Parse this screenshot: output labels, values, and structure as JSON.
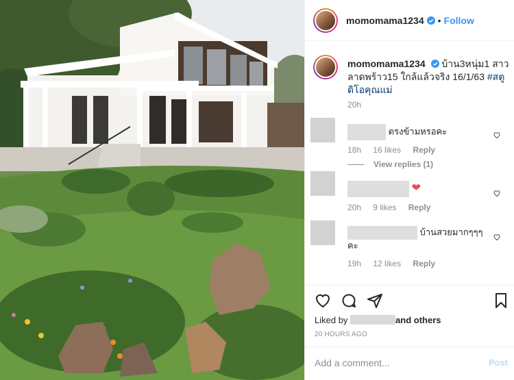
{
  "post": {
    "username": "momomama1234",
    "follow_label": "Follow",
    "dot": "•",
    "caption_username": "momomama1234",
    "caption_text": "บ้าน3หนุ่ม1 สาว ลาดพร้าว15 ใกล้แล้วจริง 16/1/63",
    "caption_hashtag": "#สตูดิโอคุณแม่",
    "caption_time": "20h"
  },
  "comments": [
    {
      "text": "ตรงข้ามหรอคะ",
      "time": "18h",
      "likes": "16 likes",
      "reply_label": "Reply",
      "view_replies": "View replies (1)"
    },
    {
      "emoji": "❤",
      "time": "20h",
      "likes": "9 likes",
      "reply_label": "Reply"
    },
    {
      "text": "บ้านสวยมากๆๆๆ คะ",
      "time": "19h",
      "likes": "12 likes",
      "reply_label": "Reply"
    }
  ],
  "footer": {
    "liked_by_prefix": "Liked by",
    "liked_by_suffix": "and others",
    "posted_ago": "20 HOURS AGO",
    "add_comment_placeholder": "Add a comment...",
    "post_label": "Post"
  },
  "colors": {
    "link_blue": "#3897f0",
    "heart_red": "#ed4956",
    "muted": "#8e8e8e"
  },
  "icons": [
    "verified-badge-icon",
    "heart-icon",
    "comment-icon",
    "share-icon",
    "bookmark-icon"
  ]
}
